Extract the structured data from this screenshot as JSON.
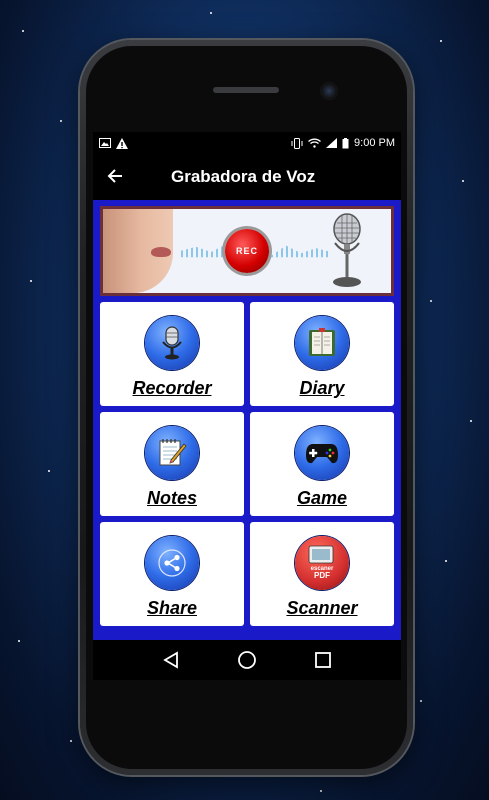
{
  "status": {
    "time": "9:00 PM",
    "left_icons": [
      "image-icon",
      "warning-icon"
    ],
    "right_icons": [
      "vibrate-icon",
      "wifi-icon",
      "signal-icon",
      "battery-icon"
    ]
  },
  "app_bar": {
    "title": "Grabadora de Voz",
    "back_icon": "arrow-left-icon"
  },
  "banner": {
    "rec_label": "REC"
  },
  "menu": {
    "items": [
      {
        "label": "Recorder",
        "icon": "microphone-icon"
      },
      {
        "label": "Diary",
        "icon": "notebook-icon"
      },
      {
        "label": "Notes",
        "icon": "notepad-pencil-icon"
      },
      {
        "label": "Game",
        "icon": "gamepad-icon"
      },
      {
        "label": "Share",
        "icon": "share-icon"
      },
      {
        "label": "Scanner",
        "icon": "pdf-scanner-icon"
      }
    ]
  },
  "scanner_icon_text": {
    "line1": "escaner",
    "line2": "PDF"
  },
  "nav": {
    "back": "nav-back-icon",
    "home": "nav-home-icon",
    "recents": "nav-recents-icon"
  },
  "colors": {
    "content_bg": "#1a1ac8",
    "icon_blue": "#2f6ce8",
    "banner_border": "#6b2f3c"
  }
}
